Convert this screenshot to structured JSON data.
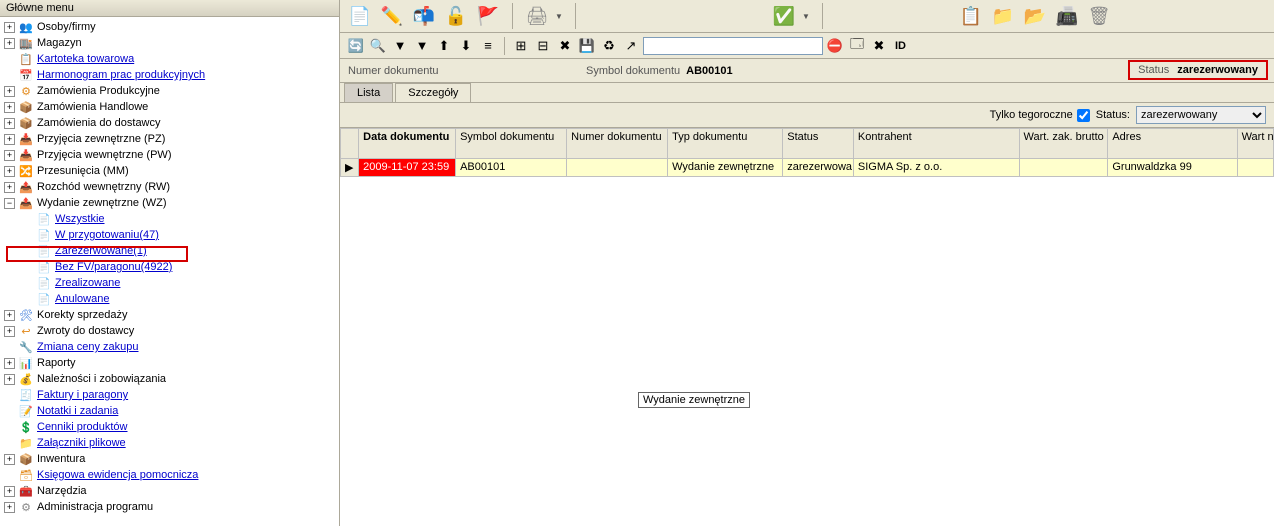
{
  "sidebar": {
    "title": "Główne menu",
    "items": [
      {
        "depth": 0,
        "exp": "+",
        "icon": "👥",
        "ic": "ic-blue",
        "label": "Osoby/firmy",
        "link": false
      },
      {
        "depth": 0,
        "exp": "+",
        "icon": "🏬",
        "ic": "ic-orange",
        "label": "Magazyn",
        "link": false
      },
      {
        "depth": 0,
        "exp": "",
        "icon": "📋",
        "ic": "ic-blue",
        "label": "Kartoteka towarowa",
        "link": true
      },
      {
        "depth": 0,
        "exp": "",
        "icon": "📅",
        "ic": "ic-blue",
        "label": "Harmonogram prac produkcyjnych",
        "link": true
      },
      {
        "depth": 0,
        "exp": "+",
        "icon": "⚙",
        "ic": "ic-orange",
        "label": "Zamówienia Produkcyjne",
        "link": false
      },
      {
        "depth": 0,
        "exp": "+",
        "icon": "📦",
        "ic": "ic-orange",
        "label": "Zamówienia Handlowe",
        "link": false
      },
      {
        "depth": 0,
        "exp": "+",
        "icon": "📦",
        "ic": "ic-orange",
        "label": "Zamówienia do dostawcy",
        "link": false
      },
      {
        "depth": 0,
        "exp": "+",
        "icon": "📥",
        "ic": "ic-orange",
        "label": "Przyjęcia zewnętrzne (PZ)",
        "link": false
      },
      {
        "depth": 0,
        "exp": "+",
        "icon": "📥",
        "ic": "ic-orange",
        "label": "Przyjęcia wewnętrzne (PW)",
        "link": false
      },
      {
        "depth": 0,
        "exp": "+",
        "icon": "🔀",
        "ic": "ic-orange",
        "label": "Przesunięcia (MM)",
        "link": false
      },
      {
        "depth": 0,
        "exp": "+",
        "icon": "📤",
        "ic": "ic-orange",
        "label": "Rozchód wewnętrzny (RW)",
        "link": false
      },
      {
        "depth": 0,
        "exp": "−",
        "icon": "📤",
        "ic": "ic-orange",
        "label": "Wydanie zewnętrzne (WZ)",
        "link": false
      },
      {
        "depth": 1,
        "exp": "",
        "icon": "📄",
        "ic": "ic-blue",
        "label": "Wszystkie",
        "link": true
      },
      {
        "depth": 1,
        "exp": "",
        "icon": "📄",
        "ic": "ic-blue",
        "label": "W przygotowaniu(47)",
        "link": true
      },
      {
        "depth": 1,
        "exp": "",
        "icon": "📄",
        "ic": "ic-blue",
        "label": "Zarezerwowane(1)",
        "link": true,
        "highlight": true
      },
      {
        "depth": 1,
        "exp": "",
        "icon": "📄",
        "ic": "ic-blue",
        "label": "Bez FV/paragonu(4922)",
        "link": true
      },
      {
        "depth": 1,
        "exp": "",
        "icon": "📄",
        "ic": "ic-blue",
        "label": "Zrealizowane",
        "link": true
      },
      {
        "depth": 1,
        "exp": "",
        "icon": "📄",
        "ic": "ic-gray",
        "label": "Anulowane",
        "link": true
      },
      {
        "depth": 0,
        "exp": "+",
        "icon": "🛠",
        "ic": "ic-blue",
        "label": "Korekty sprzedaży",
        "link": false
      },
      {
        "depth": 0,
        "exp": "+",
        "icon": "↩",
        "ic": "ic-orange",
        "label": "Zwroty do dostawcy",
        "link": false
      },
      {
        "depth": 0,
        "exp": "",
        "icon": "🔧",
        "ic": "ic-orange",
        "label": "Zmiana ceny zakupu",
        "link": true
      },
      {
        "depth": 0,
        "exp": "+",
        "icon": "📊",
        "ic": "ic-blue",
        "label": "Raporty",
        "link": false
      },
      {
        "depth": 0,
        "exp": "+",
        "icon": "💰",
        "ic": "ic-orange",
        "label": "Należności i zobowiązania",
        "link": false
      },
      {
        "depth": 0,
        "exp": "",
        "icon": "🧾",
        "ic": "ic-yellow",
        "label": "Faktury i paragony",
        "link": true
      },
      {
        "depth": 0,
        "exp": "",
        "icon": "📝",
        "ic": "ic-blue",
        "label": "Notatki i zadania",
        "link": true
      },
      {
        "depth": 0,
        "exp": "",
        "icon": "💲",
        "ic": "ic-blue",
        "label": "Cenniki produktów",
        "link": true
      },
      {
        "depth": 0,
        "exp": "",
        "icon": "📁",
        "ic": "ic-yellow",
        "label": "Załączniki plikowe",
        "link": true
      },
      {
        "depth": 0,
        "exp": "+",
        "icon": "📦",
        "ic": "ic-gray",
        "label": "Inwentura",
        "link": false
      },
      {
        "depth": 0,
        "exp": "",
        "icon": "🗃",
        "ic": "ic-orange",
        "label": "Księgowa ewidencja pomocnicza",
        "link": true
      },
      {
        "depth": 0,
        "exp": "+",
        "icon": "🧰",
        "ic": "ic-orange",
        "label": "Narzędzia",
        "link": false
      },
      {
        "depth": 0,
        "exp": "+",
        "icon": "⚙",
        "ic": "ic-gray",
        "label": "Administracja programu",
        "link": false
      }
    ]
  },
  "toolbar1": {
    "buttons": [
      {
        "name": "new-button",
        "glyph": "📄",
        "ic": "ic-green"
      },
      {
        "name": "edit-button",
        "glyph": "✏️",
        "ic": "ic-yellow"
      },
      {
        "name": "open-button",
        "glyph": "📬",
        "ic": "ic-blue"
      },
      {
        "name": "unlock-button",
        "glyph": "🔓",
        "ic": "ic-orange"
      },
      {
        "name": "flag-button",
        "glyph": "🚩",
        "ic": "ic-red"
      }
    ],
    "group2": [
      {
        "name": "print-button",
        "glyph": "🖨",
        "ic": "ic-gray",
        "drop": true
      }
    ],
    "group3": [
      {
        "name": "check-button",
        "glyph": "✅",
        "ic": "ic-red",
        "drop": true
      }
    ],
    "group4": [
      {
        "name": "clipboard-button",
        "glyph": "📋",
        "ic": "ic-orange"
      },
      {
        "name": "add-folder-button",
        "glyph": "📁",
        "ic": "ic-green"
      },
      {
        "name": "open-folder-button",
        "glyph": "📂",
        "ic": "ic-yellow"
      },
      {
        "name": "scan-button",
        "glyph": "📠",
        "ic": "ic-gray"
      },
      {
        "name": "archive-button",
        "glyph": "🗑",
        "ic": "ic-gray"
      }
    ]
  },
  "toolbar2": {
    "buttons": [
      {
        "name": "refresh-icon",
        "glyph": "🔄"
      },
      {
        "name": "find-icon",
        "glyph": "🔍"
      },
      {
        "name": "filter1-icon",
        "glyph": "▼"
      },
      {
        "name": "filter2-icon",
        "glyph": "▼"
      },
      {
        "name": "sort-asc-icon",
        "glyph": "⬆"
      },
      {
        "name": "sort-desc-icon",
        "glyph": "⬇"
      },
      {
        "name": "group-icon",
        "glyph": "≡"
      },
      {
        "name": "groupsep",
        "glyph": "|",
        "sep": true
      },
      {
        "name": "grid1-icon",
        "glyph": "⊞"
      },
      {
        "name": "grid2-icon",
        "glyph": "⊟"
      },
      {
        "name": "close-red-icon",
        "glyph": "✖"
      },
      {
        "name": "save-icon",
        "glyph": "💾"
      },
      {
        "name": "reload-icon",
        "glyph": "♻"
      },
      {
        "name": "popout-icon",
        "glyph": "↗"
      }
    ],
    "after": [
      {
        "name": "redstop-icon",
        "glyph": "⛔"
      },
      {
        "name": "bluewin-icon",
        "glyph": "🗔"
      },
      {
        "name": "delete2-icon",
        "glyph": "✖"
      },
      {
        "name": "id-label",
        "glyph": "ID",
        "text": true
      }
    ]
  },
  "infobar": {
    "numer_label": "Numer dokumentu",
    "numer_value": "",
    "symbol_label": "Symbol dokumentu",
    "symbol_value": "AB00101",
    "status_label": "Status",
    "status_value": "zarezerwowany"
  },
  "tabs": {
    "lista": "Lista",
    "szczegoly": "Szczegóły",
    "active": "lista"
  },
  "filterbar": {
    "tylko_label": "Tylko tegoroczne",
    "tylko_checked": true,
    "status_label": "Status:",
    "status_value": "zarezerwowany",
    "status_options": [
      "zarezerwowany"
    ]
  },
  "grid": {
    "columns": [
      {
        "key": "mark",
        "label": "",
        "cls": "col-mark"
      },
      {
        "key": "data",
        "label": "Data dokumentu",
        "cls": "col-date",
        "bold": true
      },
      {
        "key": "symbol",
        "label": "Symbol dokumentu",
        "cls": "col-sym"
      },
      {
        "key": "numer",
        "label": "Numer dokumentu",
        "cls": "col-nd"
      },
      {
        "key": "typ",
        "label": "Typ dokumentu",
        "cls": "col-td"
      },
      {
        "key": "status",
        "label": "Status",
        "cls": "col-st"
      },
      {
        "key": "kontrahent",
        "label": "Kontrahent",
        "cls": "col-kt"
      },
      {
        "key": "wart",
        "label": "Wart. zak. brutto",
        "cls": "col-wb"
      },
      {
        "key": "adres",
        "label": "Adres",
        "cls": "col-ad"
      },
      {
        "key": "wartnetto",
        "label": "Wart netto",
        "cls": "col-wn"
      }
    ],
    "rows": [
      {
        "mark": "▶",
        "data": "2009-11-07 23:59",
        "symbol": "AB00101",
        "numer": "",
        "typ": "Wydanie zewnętrzne",
        "status": "zarezerwowa",
        "kontrahent": "SIGMA Sp. z o.o.",
        "wart": "",
        "adres": "Grunwaldzka 99",
        "wartnetto": ""
      }
    ]
  },
  "floating_label": "Wydanie zewnętrzne"
}
